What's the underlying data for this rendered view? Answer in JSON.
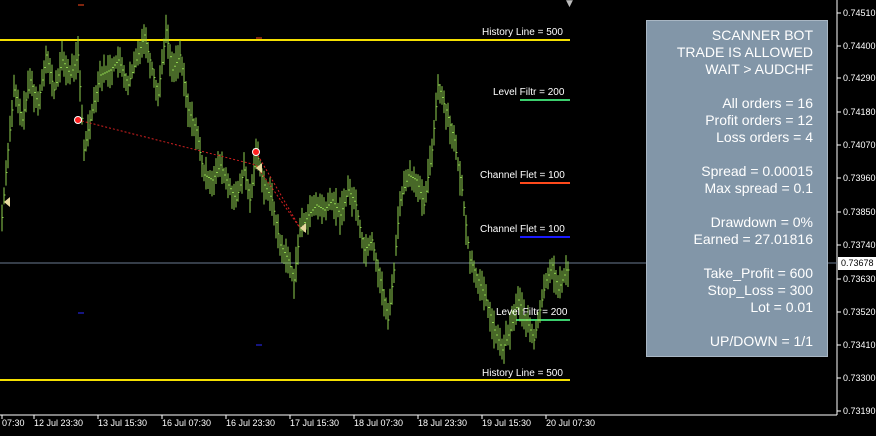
{
  "panel": {
    "line1": "SCANNER BOT",
    "line2": "TRADE IS ALLOWED",
    "line3": "WAIT > AUDCHF",
    "all_orders": "All orders = 16",
    "profit_orders": "Profit orders = 12",
    "loss_orders": "Loss orders = 4",
    "spread": "Spread =  0.00015",
    "max_spread": "Max spread =  0.1",
    "drawdown": "Drawdown  = 0%",
    "earned": "Earned = 27.01816",
    "take_profit": "Take_Profit = 600",
    "stop_loss": "Stop_Loss = 300",
    "lot": "Lot = 0.01",
    "updown": "UP/DOWN = 1/1"
  },
  "levels": {
    "history_top": "History Line = 500",
    "level_filtr_top": "Level Filtr = 200",
    "channel_flet_1": "Channel Flet = 100",
    "channel_flet_2": "Channel Flet = 100",
    "level_filtr_bottom": "Level Filtr = 200",
    "history_bottom": "History Line = 500"
  },
  "price_axis": [
    "0.74510",
    "0.74400",
    "0.74290",
    "0.74180",
    "0.74070",
    "0.73960",
    "0.73850",
    "0.73740",
    "0.73630",
    "0.73520",
    "0.73410",
    "0.73300",
    "0.73190"
  ],
  "current_price": "0.73678",
  "time_axis": [
    "07:30",
    "12 Jul 23:30",
    "13 Jul 15:30",
    "16 Jul 07:30",
    "16 Jul 23:30",
    "17 Jul 15:30",
    "18 Jul 07:30",
    "18 Jul 23:30",
    "19 Jul 15:30",
    "20 Jul 07:30"
  ],
  "colors": {
    "background": "#000000",
    "bars": "#8fd14f",
    "history_line": "#f5e000",
    "level_filtr": "#3ccf6e",
    "channel_flet_1": "#ff4a1c",
    "channel_flet_2": "#1a1aff",
    "panel_bg": "#8296a8",
    "handwriting": "#e00000"
  }
}
